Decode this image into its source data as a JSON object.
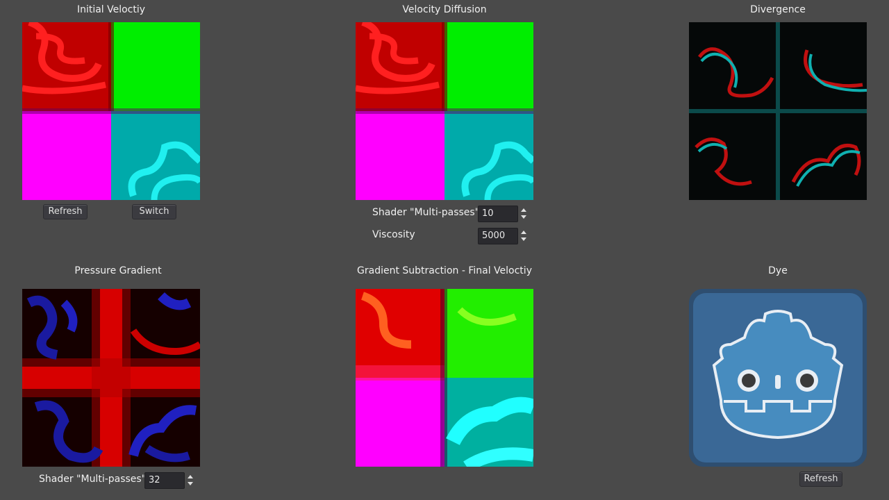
{
  "panels": {
    "initial_velocity": {
      "title": "Initial Veloctiy",
      "refresh_label": "Refresh",
      "switch_label": "Switch"
    },
    "velocity_diffusion": {
      "title": "Velocity Diffusion",
      "multipasses_label": "Shader \"Multi-passes\"",
      "multipasses_value": "10",
      "viscosity_label": "Viscosity",
      "viscosity_value": "5000"
    },
    "divergence": {
      "title": "Divergence"
    },
    "pressure_gradient": {
      "title": "Pressure Gradient",
      "multipasses_label": "Shader \"Multi-passes\"",
      "multipasses_value": "32"
    },
    "gradient_subtraction": {
      "title": "Gradient Subtraction - Final Veloctiy"
    },
    "dye": {
      "title": "Dye",
      "refresh_label": "Refresh",
      "image_icon": "godot-logo-icon"
    }
  },
  "colors": {
    "background": "#4a4a4a",
    "red": "#ff0000",
    "green": "#00ff00",
    "magenta": "#ff00ff",
    "cyan": "#00ffff",
    "godot_blue": "#478cbf"
  }
}
